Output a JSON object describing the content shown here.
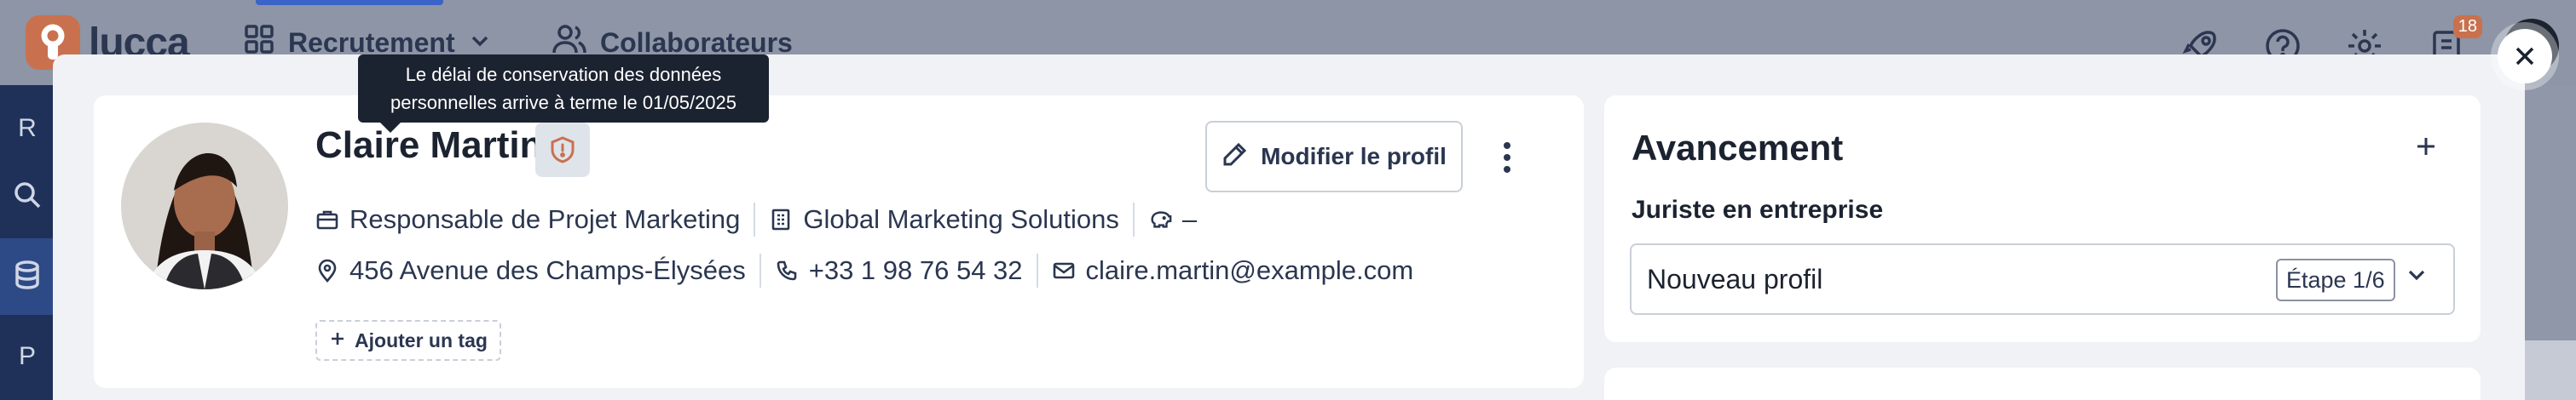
{
  "topbar": {
    "logo_text": "lucca",
    "nav": [
      {
        "label": "Recrutement",
        "icon": "grid-icon"
      },
      {
        "label": "Collaborateurs",
        "icon": "people-icon"
      }
    ],
    "notification_count": "18"
  },
  "sidebar": {
    "item_r": "R",
    "item_p": "P"
  },
  "tooltip": {
    "line1": "Le délai de conservation des données",
    "line2": "personnelles arrive à terme le 01/05/2025"
  },
  "profile": {
    "name": "Claire Martin",
    "edit_label": "Modifier le profil",
    "job_title": "Responsable de Projet Marketing",
    "company": "Global Marketing Solutions",
    "salary": "–",
    "address": "456 Avenue des Champs-Élysées",
    "phone": "+33 1 98 76 54 32",
    "email": "claire.martin@example.com",
    "add_tag_label": "Ajouter un tag"
  },
  "avancement": {
    "title": "Avancement",
    "position": "Juriste en entreprise",
    "stage": "Nouveau profil",
    "step": "Étape 1/6"
  },
  "colors": {
    "accent": "#c9714e",
    "dark": "#1c2330",
    "overlay": "#8f97a8"
  }
}
